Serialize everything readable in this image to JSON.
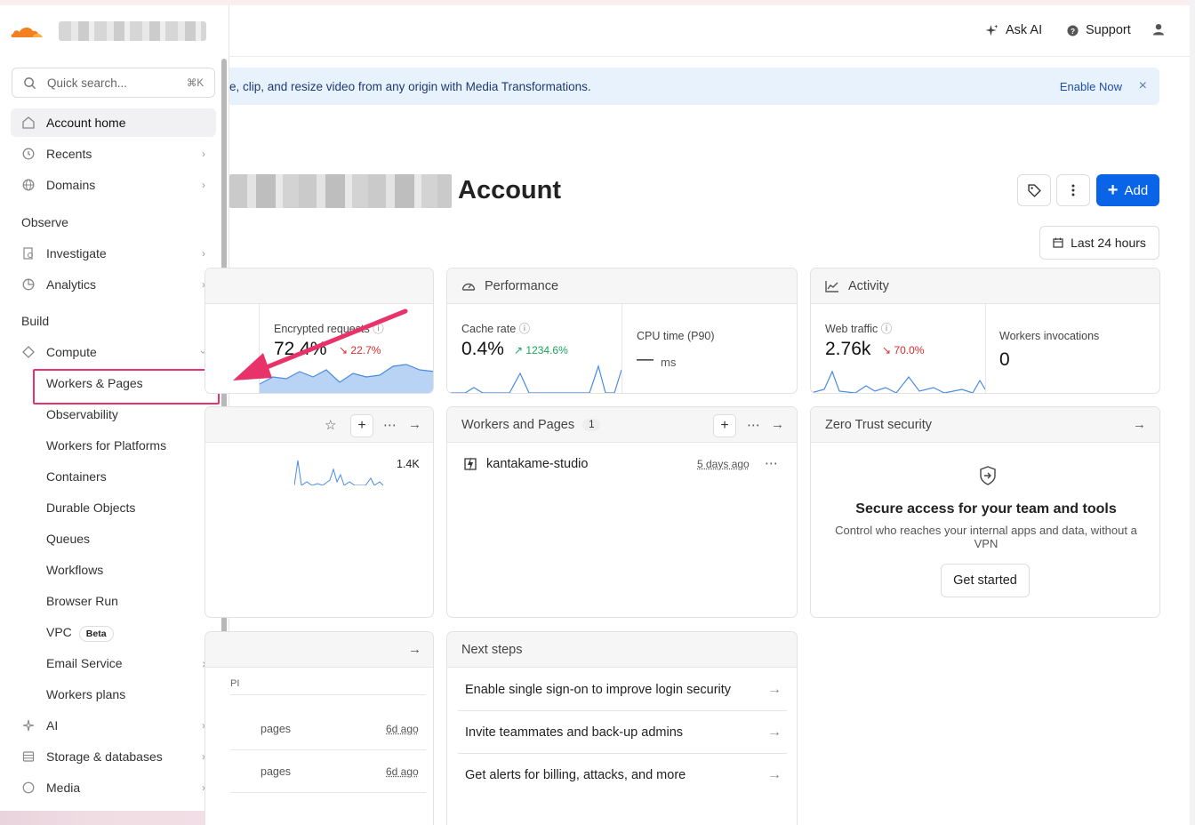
{
  "header": {
    "ask_ai": "Ask AI",
    "support": "Support"
  },
  "search": {
    "placeholder": "Quick search...",
    "shortcut": "⌘K"
  },
  "sidebar": {
    "account_home": "Account home",
    "recents": "Recents",
    "domains": "Domains",
    "observe": "Observe",
    "investigate": "Investigate",
    "analytics": "Analytics",
    "build": "Build",
    "compute": "Compute",
    "sub": [
      "Workers & Pages",
      "Observability",
      "Workers for Platforms",
      "Containers",
      "Durable Objects",
      "Queues",
      "Workflows",
      "Browser Run",
      "VPC",
      "Email Service",
      "Workers plans"
    ],
    "vpc_badge": "Beta",
    "ai": "AI",
    "storage": "Storage & databases",
    "media": "Media"
  },
  "banner": {
    "text": "e, clip, and resize video from any origin with Media Transformations.",
    "enable": "Enable Now",
    "close": "×"
  },
  "page": {
    "title": "Account",
    "add": "Add",
    "date_range": "Last 24 hours"
  },
  "traffic_card": {
    "label": "Encrypted requests",
    "value": "72.4%",
    "delta": "↘ 22.7%"
  },
  "performance_card": {
    "title": "Performance",
    "cache_label": "Cache rate",
    "cache_value": "0.4%",
    "cache_delta": "↗ 1234.6%",
    "cpu_label": "CPU time (P90)",
    "cpu_value": "—",
    "cpu_unit": "ms"
  },
  "activity_card": {
    "title": "Activity",
    "web_label": "Web traffic",
    "web_value": "2.76k",
    "web_delta": "↘ 70.0%",
    "inv_label": "Workers invocations",
    "inv_value": "0"
  },
  "domains_card": {
    "value": "1.4K"
  },
  "workers_card": {
    "title": "Workers and Pages",
    "count": "1",
    "item": "kantakame-studio",
    "item_time": "5 days ago"
  },
  "zt_card": {
    "title": "Zero Trust security",
    "heading": "Secure access for your team and tools",
    "desc": "Control who reaches your internal apps and data, without a VPN",
    "button": "Get started"
  },
  "activity_list": {
    "col": "PI",
    "rows": [
      {
        "type": "pages",
        "time": "6d ago"
      },
      {
        "type": "pages",
        "time": "6d ago"
      }
    ]
  },
  "next_steps": {
    "title": "Next steps",
    "items": [
      "Enable single sign-on to improve login security",
      "Invite teammates and back-up admins",
      "Get alerts for billing, attacks, and more"
    ]
  },
  "colors": {
    "accent": "#0a64e8",
    "highlight": "#e8336a",
    "up": "#1ba35b",
    "down": "#d92d2d",
    "logo": "#f38020"
  }
}
